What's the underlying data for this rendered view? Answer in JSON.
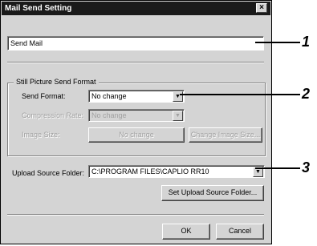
{
  "window": {
    "title": "Mail Send Setting",
    "close_glyph": "×"
  },
  "name_field": {
    "value": "Send Mail"
  },
  "group": {
    "title": "Still Picture Send Format"
  },
  "send_format": {
    "label": "Send Format:",
    "value": "No change"
  },
  "compression": {
    "label": "Compression Rate:",
    "value": "No change"
  },
  "image_size": {
    "label": "Image Size:",
    "value": "No change",
    "button": "Change Image Size..."
  },
  "upload": {
    "label": "Upload Source Folder:",
    "value": "C:\\PROGRAM FILES\\CAPLIO RR10",
    "set_button": "Set Upload Source Folder..."
  },
  "buttons": {
    "ok": "OK",
    "cancel": "Cancel"
  },
  "callouts": [
    "1",
    "2",
    "3"
  ],
  "icons": {
    "dropdown": "dropdown-arrow-icon",
    "close": "close-icon"
  }
}
